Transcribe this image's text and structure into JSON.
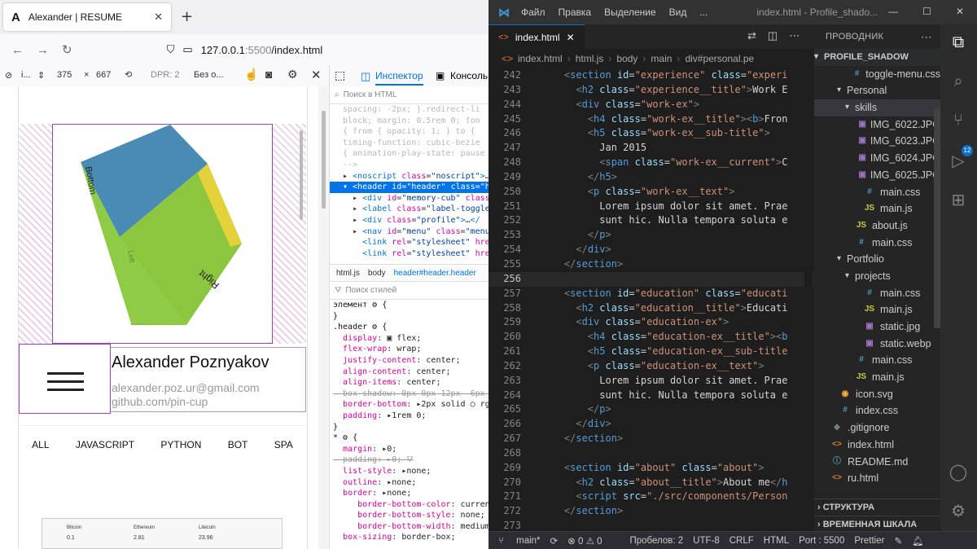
{
  "browser": {
    "tab_title": "Alexander | RESUME",
    "tab_close": "✕",
    "new_tab": "+",
    "url_host": "127.0.0.1",
    "url_port": ":5500",
    "url_path": "/index.html",
    "rdm": {
      "device": "i...",
      "width": "375",
      "x": "×",
      "height": "667",
      "dpr": "DPR: 2",
      "throttle": "Без о..."
    },
    "devtools_tabs": {
      "inspector": "Инспектор",
      "console": "Консоль"
    }
  },
  "page": {
    "cube_faces": [
      "Bottom",
      "Left",
      "Right"
    ],
    "name": "Alexander Poznyakov",
    "email": "alexander.poz.ur@gmail.com",
    "github": "github.com/pin-cup",
    "filters": [
      "ALL",
      "JAVASCRIPT",
      "PYTHON",
      "BOT",
      "SPA"
    ],
    "thumb": {
      "h1": "Bitcoin",
      "h2": "Ethereum",
      "h3": "Litecoin",
      "v1": "0.1",
      "v2": "2.81",
      "v3": "23.96"
    }
  },
  "inspector": {
    "search_placeholder": "Поиск в HTML",
    "breadcrumbs": [
      "html.js",
      "body",
      "header#header.header"
    ],
    "styles_filter_placeholder": "Поиск стилей"
  },
  "editor": {
    "menu": [
      "Файл",
      "Правка",
      "Выделение",
      "Вид"
    ],
    "more": "...",
    "window_title": "index.html - Profile_shado...",
    "tab_label": "index.html",
    "tab_tag": "<>",
    "breadcrumbs": [
      "index.html",
      "html.js",
      "body",
      "main",
      "div#personal.pe"
    ],
    "explorer_title": "ПРОВОДНИК",
    "root_folder": "PROFILE_SHADOW",
    "tree": [
      {
        "name": "toggle-menu.css",
        "type": "css",
        "depth": 3
      },
      {
        "name": "Personal",
        "type": "folder",
        "depth": 2
      },
      {
        "name": "skills",
        "type": "folder",
        "depth": 3,
        "selected": true
      },
      {
        "name": "IMG_6022.JPG",
        "type": "img",
        "depth": 4
      },
      {
        "name": "IMG_6023.JPG",
        "type": "img",
        "depth": 4
      },
      {
        "name": "IMG_6024.JPG",
        "type": "img",
        "depth": 4
      },
      {
        "name": "IMG_6025.JPG",
        "type": "img",
        "depth": 4
      },
      {
        "name": "main.css",
        "type": "css",
        "depth": 4
      },
      {
        "name": "main.js",
        "type": "js",
        "depth": 4
      },
      {
        "name": "about.js",
        "type": "js",
        "depth": 3
      },
      {
        "name": "main.css",
        "type": "css",
        "depth": 3
      },
      {
        "name": "Portfolio",
        "type": "folder",
        "depth": 2
      },
      {
        "name": "projects",
        "type": "folder",
        "depth": 3
      },
      {
        "name": "main.css",
        "type": "css",
        "depth": 4
      },
      {
        "name": "main.js",
        "type": "js",
        "depth": 4
      },
      {
        "name": "static.jpg",
        "type": "img",
        "depth": 4
      },
      {
        "name": "static.webp",
        "type": "img",
        "depth": 4
      },
      {
        "name": "main.css",
        "type": "css",
        "depth": 3
      },
      {
        "name": "main.js",
        "type": "js",
        "depth": 3
      },
      {
        "name": "icon.svg",
        "type": "svg",
        "depth": 1
      },
      {
        "name": "index.css",
        "type": "css",
        "depth": 1
      },
      {
        "name": ".gitignore",
        "type": "git",
        "depth": 0
      },
      {
        "name": "index.html",
        "type": "html",
        "depth": 0
      },
      {
        "name": "README.md",
        "type": "md",
        "depth": 0
      },
      {
        "name": "ru.html",
        "type": "html",
        "depth": 0
      }
    ],
    "outline": "СТРУКТУРА",
    "timeline": "ВРЕМЕННАЯ ШКАЛА",
    "activity_badge": "12",
    "status": {
      "branch": "main*",
      "problems": "⊗ 0 ⚠ 0",
      "spaces": "Пробелов: 2",
      "encoding": "UTF-8",
      "eol": "CRLF",
      "lang": "HTML",
      "port": "Port : 5500",
      "prettier": "Prettier"
    }
  },
  "colors": {
    "accent": "#0074e8",
    "vscode_blue": "#0e70c0",
    "purple_outline": "#a040c0"
  }
}
